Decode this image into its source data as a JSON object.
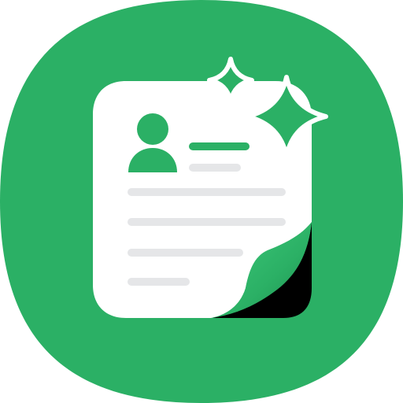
{
  "icon": {
    "kind": "app-icon",
    "subject": "resume-document-with-sparkles",
    "colors": {
      "background": "#2BB065",
      "document": "#FFFFFF",
      "accent": "#2BB065",
      "placeholder_line": "#E5E6E8",
      "page_curl_shadow": "#000000"
    }
  }
}
